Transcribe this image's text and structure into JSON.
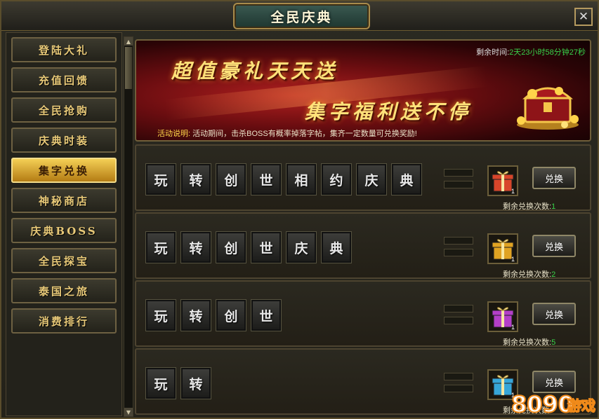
{
  "window": {
    "title": "全民庆典",
    "close_label": "✕"
  },
  "sidebar": {
    "items": [
      {
        "label": "登陆大礼",
        "active": false
      },
      {
        "label": "充值回馈",
        "active": false
      },
      {
        "label": "全民抢购",
        "active": false
      },
      {
        "label": "庆典时装",
        "active": false
      },
      {
        "label": "集字兑换",
        "active": true
      },
      {
        "label": "神秘商店",
        "active": false
      },
      {
        "label": "庆典BOSS",
        "active": false
      },
      {
        "label": "全民探宝",
        "active": false
      },
      {
        "label": "泰国之旅",
        "active": false
      },
      {
        "label": "消费排行",
        "active": false
      }
    ]
  },
  "banner": {
    "remain_label": "剩余时间:",
    "remain_value": "2天23小时58分钟27秒",
    "slogan_1": "超值豪礼天天送",
    "slogan_2": "集字福利送不停",
    "desc_label": "活动说明:",
    "desc_text": "活动期间，击杀BOSS有概率掉落字帖，集齐一定数量可兑换奖励!"
  },
  "rows": [
    {
      "chars": [
        "玩",
        "转",
        "创",
        "世",
        "相",
        "约",
        "庆",
        "典"
      ],
      "gift_count": "1",
      "gift_color": "#d8452a",
      "button": "兑换",
      "remain_label": "剩余兑换次数:",
      "remain_value": "1"
    },
    {
      "chars": [
        "玩",
        "转",
        "创",
        "世",
        "庆",
        "典"
      ],
      "gift_count": "1",
      "gift_color": "#e0a322",
      "button": "兑换",
      "remain_label": "剩余兑换次数:",
      "remain_value": "2"
    },
    {
      "chars": [
        "玩",
        "转",
        "创",
        "世"
      ],
      "gift_count": "1",
      "gift_color": "#b43fc8",
      "button": "兑换",
      "remain_label": "剩余兑换次数:",
      "remain_value": "5"
    },
    {
      "chars": [
        "玩",
        "转"
      ],
      "gift_count": "1",
      "gift_color": "#37a6d8",
      "button": "兑换",
      "remain_label": "剩余兑换次数:",
      "remain_value": ""
    }
  ],
  "watermark": {
    "digits": "8090",
    "text": "游戏"
  },
  "colors": {
    "accent_gold": "#e8c978",
    "active_tab": "#f4cf55",
    "green_value": "#39d24a"
  }
}
